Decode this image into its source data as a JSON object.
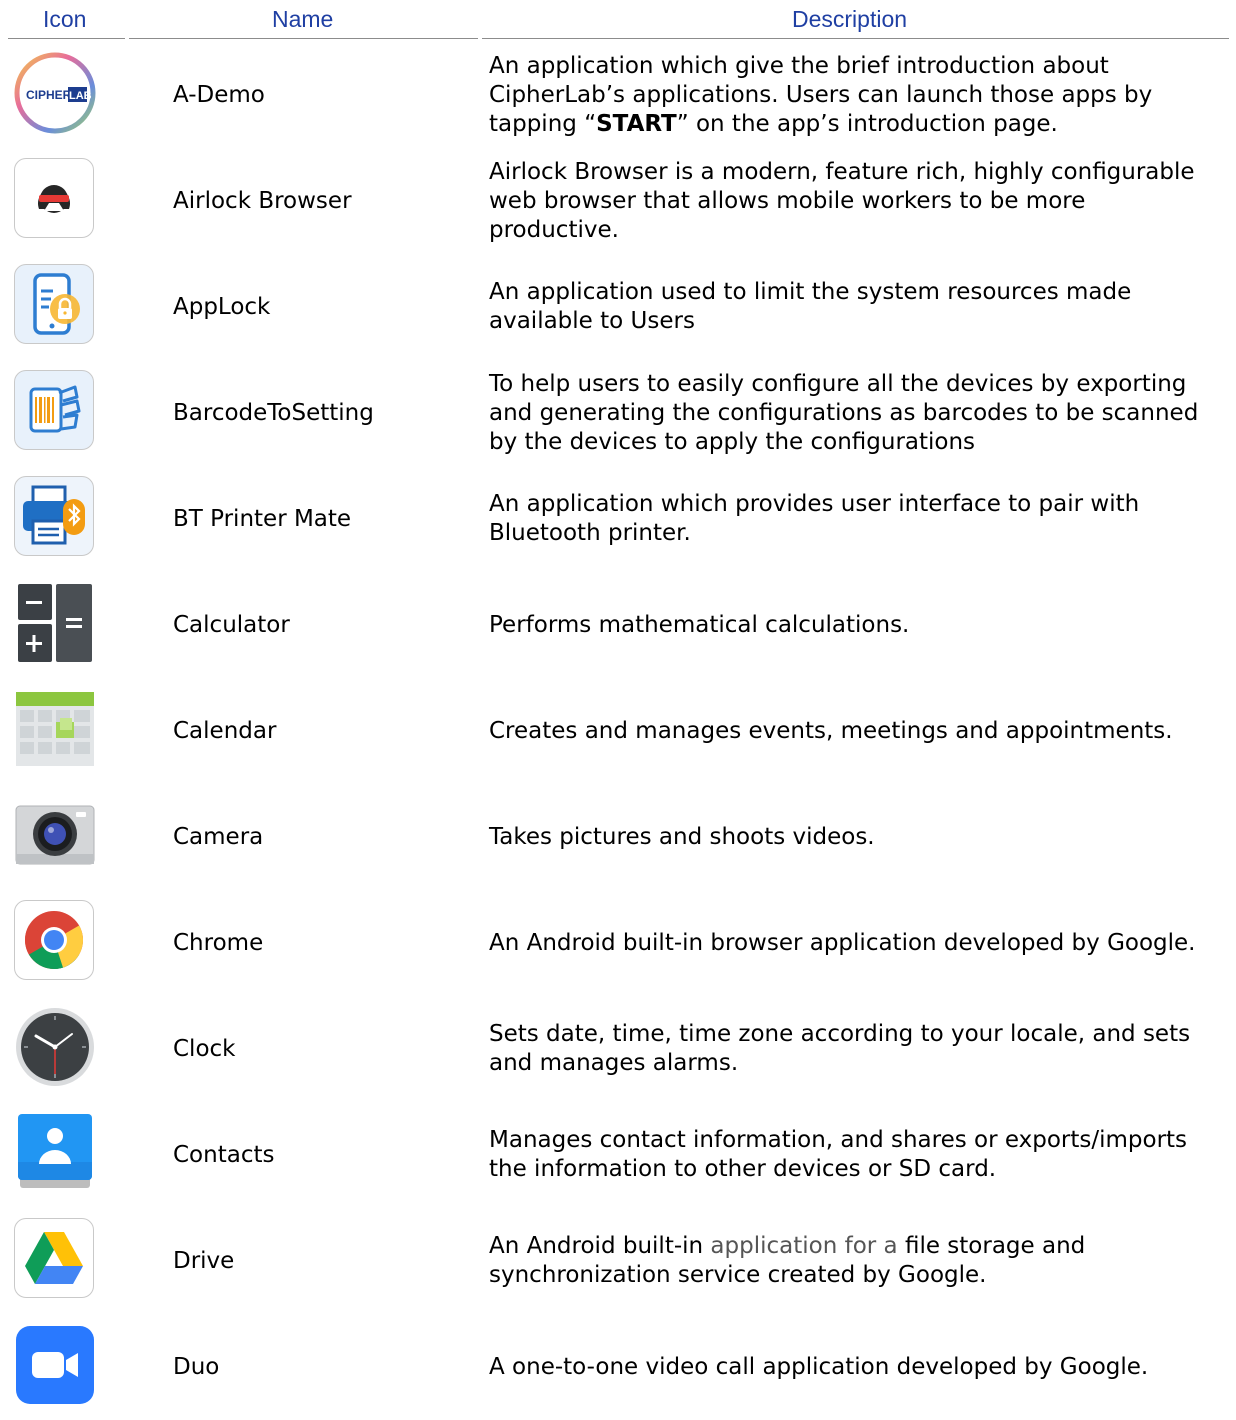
{
  "header": {
    "icon": "Icon",
    "name": "Name",
    "description": "Description"
  },
  "apps": [
    {
      "name": "A-Demo",
      "icon": "cipherlab-logo-icon",
      "desc": [
        "An application which give the brief introduction about",
        "CipherLab’s applications. Users can launch those apps by"
      ],
      "desc_pre": "tapping “",
      "desc_bold": "START",
      "desc_post": "” on the app’s introduction page."
    },
    {
      "name": "Airlock Browser",
      "icon": "airlock-icon",
      "desc": [
        "Airlock Browser is a modern, feature rich, highly configurable",
        "web browser that allows mobile workers to be more",
        "productive."
      ]
    },
    {
      "name": "AppLock",
      "icon": "applock-icon",
      "desc": [
        "An application used to limit the system resources made",
        "available to Users"
      ]
    },
    {
      "name": "BarcodeToSetting",
      "icon": "barcode-setting-icon",
      "desc": [
        "To help users to easily configure all the devices by exporting",
        "and generating the configurations as barcodes to be scanned",
        "by the devices to apply the configurations"
      ]
    },
    {
      "name": "BT Printer Mate",
      "icon": "bt-printer-icon",
      "desc": [
        "An application which provides user interface to pair with",
        "Bluetooth printer."
      ]
    },
    {
      "name": "Calculator",
      "icon": "calculator-icon",
      "desc": [
        "Performs mathematical calculations."
      ]
    },
    {
      "name": "Calendar",
      "icon": "calendar-icon",
      "desc": [
        "Creates and manages events, meetings and appointments."
      ]
    },
    {
      "name": "Camera",
      "icon": "camera-icon",
      "desc": [
        "Takes pictures and shoots videos."
      ]
    },
    {
      "name": "Chrome",
      "icon": "chrome-icon",
      "desc": [
        "An Android built-in browser application developed by Google."
      ]
    },
    {
      "name": "Clock",
      "icon": "clock-icon",
      "desc": [
        "Sets date, time, time zone according to your locale, and sets",
        "and manages alarms."
      ]
    },
    {
      "name": "Contacts",
      "icon": "contacts-icon",
      "desc": [
        "Manages contact information, and shares or exports/imports",
        "the information to other devices or SD card."
      ]
    },
    {
      "name": "Drive",
      "icon": "drive-icon",
      "desc_a": "An Android built-in ",
      "desc_b": "application for a",
      "desc_c": " file storage and",
      "desc": [
        "synchronization service created by Google."
      ]
    },
    {
      "name": "Duo",
      "icon": "duo-icon",
      "desc": [
        "A one-to-one video call application developed by Google."
      ]
    }
  ]
}
